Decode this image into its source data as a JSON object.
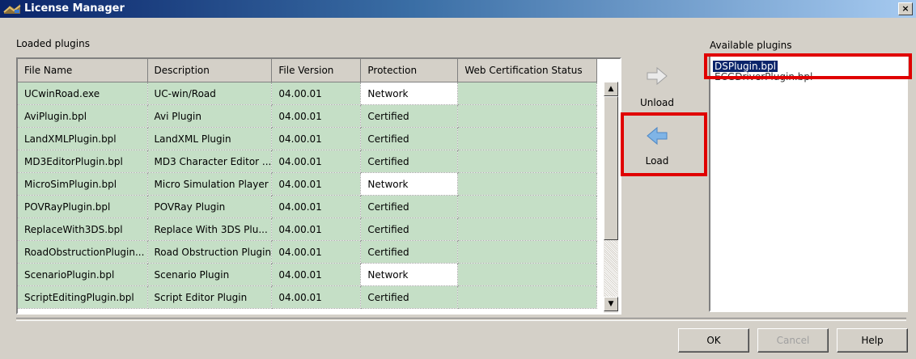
{
  "window": {
    "title": "License Manager",
    "close_label": "×"
  },
  "loaded": {
    "label": "Loaded plugins",
    "columns": [
      "File Name",
      "Description",
      "File Version",
      "Protection",
      "Web Certification Status"
    ],
    "rows": [
      [
        "UCwinRoad.exe",
        "UC-win/Road",
        "04.00.01",
        "Network",
        ""
      ],
      [
        "AviPlugin.bpl",
        "Avi Plugin",
        "04.00.01",
        "Certified",
        ""
      ],
      [
        "LandXMLPlugin.bpl",
        "LandXML Plugin",
        "04.00.01",
        "Certified",
        ""
      ],
      [
        "MD3EditorPlugin.bpl",
        "MD3 Character Editor ...",
        "04.00.01",
        "Certified",
        ""
      ],
      [
        "MicroSimPlugin.bpl",
        "Micro Simulation Player",
        "04.00.01",
        "Network",
        ""
      ],
      [
        "POVRayPlugin.bpl",
        "POVRay Plugin",
        "04.00.01",
        "Certified",
        ""
      ],
      [
        "ReplaceWith3DS.bpl",
        "Replace With 3DS Plu...",
        "04.00.01",
        "Certified",
        ""
      ],
      [
        "RoadObstructionPlugin...",
        "Road Obstruction Plugin",
        "04.00.01",
        "Certified",
        ""
      ],
      [
        "ScenarioPlugin.bpl",
        "Scenario Plugin",
        "04.00.01",
        "Network",
        ""
      ],
      [
        "ScriptEditingPlugin.bpl",
        "Script Editor Plugin",
        "04.00.01",
        "Certified",
        ""
      ]
    ]
  },
  "actions": {
    "unload_label": "Unload",
    "load_label": "Load"
  },
  "available": {
    "label": "Available plugins",
    "items": [
      {
        "text": "DSPlugin.bpl",
        "selected": true
      },
      {
        "text": "ECGDriverPlugin.bpl",
        "selected": false
      }
    ]
  },
  "footer": {
    "ok_label": "OK",
    "cancel_label": "Cancel",
    "help_label": "Help"
  },
  "colors": {
    "row_bg": "#c5dfc6",
    "highlight": "#e00000",
    "selection": "#0a246a"
  }
}
